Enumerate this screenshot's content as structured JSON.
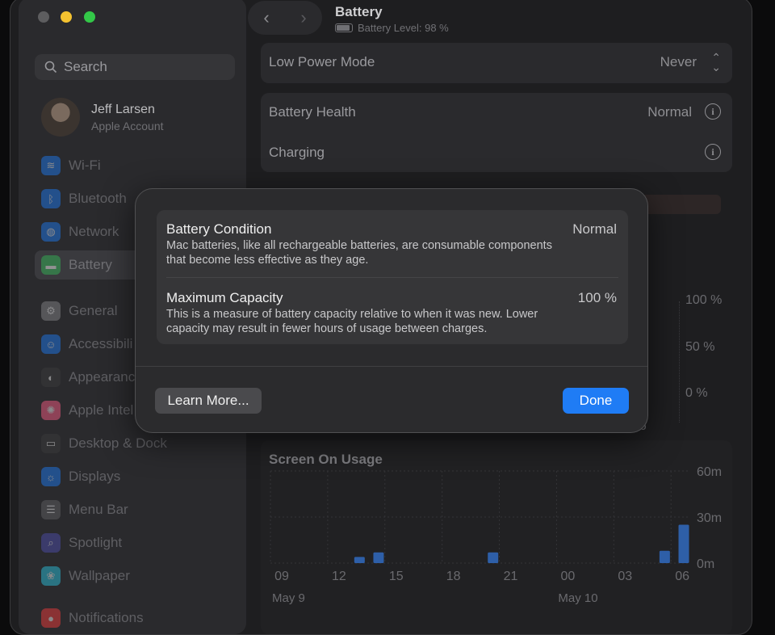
{
  "window": {
    "title": "Battery",
    "subtitle": "Battery Level: 98 %"
  },
  "sidebar": {
    "search_placeholder": "Search",
    "account": {
      "name": "Jeff Larsen",
      "subtitle": "Apple Account"
    },
    "items": [
      {
        "label": "Wi-Fi",
        "icon": "wifi-icon",
        "color": "#1e6fd9"
      },
      {
        "label": "Bluetooth",
        "icon": "bluetooth-icon",
        "color": "#1e6fd9"
      },
      {
        "label": "Network",
        "icon": "globe-icon",
        "color": "#1e6fd9"
      },
      {
        "label": "Battery",
        "icon": "battery-icon",
        "color": "#34a853",
        "active": true
      },
      {
        "label": "General",
        "icon": "gear-icon",
        "color": "#7a7a7e"
      },
      {
        "label": "Accessibili",
        "icon": "accessibility-icon",
        "color": "#1e6fd9"
      },
      {
        "label": "Appearanc",
        "icon": "appearance-icon",
        "color": "#3a3a3a"
      },
      {
        "label": "Apple Intel",
        "icon": "apple-intelligence-icon",
        "color": "#e0567a"
      },
      {
        "label": "Desktop & Dock",
        "icon": "dock-icon",
        "color": "#3a3a3a"
      },
      {
        "label": "Displays",
        "icon": "displays-icon",
        "color": "#1e6fd9"
      },
      {
        "label": "Menu Bar",
        "icon": "menubar-icon",
        "color": "#5a5a5e"
      },
      {
        "label": "Spotlight",
        "icon": "spotlight-icon",
        "color": "#4a4a9e"
      },
      {
        "label": "Wallpaper",
        "icon": "wallpaper-icon",
        "color": "#2ab0c8"
      },
      {
        "label": "Notifications",
        "icon": "notifications-icon",
        "color": "#d93a3a"
      }
    ]
  },
  "main": {
    "low_power": {
      "label": "Low Power Mode",
      "value": "Never"
    },
    "health": {
      "label": "Battery Health",
      "value": "Normal"
    },
    "charging": {
      "label": "Charging"
    },
    "hidden_tab_fragment": "ys",
    "level_chart": {
      "y_ticks": [
        "100 %",
        "50 %",
        "0 %"
      ],
      "x_fragment": "06"
    },
    "usage_chart": {
      "title": "Screen On Usage",
      "y_ticks": [
        "60m",
        "30m",
        "0m"
      ],
      "x_ticks": [
        "09",
        "12",
        "15",
        "18",
        "21",
        "00",
        "03",
        "06"
      ],
      "date_labels": [
        "May 9",
        "May 10"
      ]
    }
  },
  "modal": {
    "condition": {
      "title": "Battery Condition",
      "value": "Normal",
      "description": "Mac batteries, like all rechargeable batteries, are consumable components that become less effective as they age."
    },
    "capacity": {
      "title": "Maximum Capacity",
      "value": "100 %",
      "description": "This is a measure of battery capacity relative to when it was new. Lower capacity may result in fewer hours of usage between charges."
    },
    "learn_more": "Learn More...",
    "done": "Done"
  },
  "chart_data": {
    "type": "bar",
    "title": "Screen On Usage",
    "categories": [
      "09",
      "10",
      "11",
      "12",
      "13",
      "14",
      "15",
      "16",
      "17",
      "18",
      "19",
      "20",
      "21",
      "22",
      "23",
      "00",
      "01",
      "02",
      "03",
      "04",
      "05",
      "06"
    ],
    "values": [
      0,
      0,
      0,
      0,
      4,
      7,
      0,
      0,
      0,
      0,
      0,
      7,
      0,
      0,
      0,
      0,
      0,
      0,
      0,
      0,
      8,
      25
    ],
    "ylabel": "minutes",
    "ylim": [
      0,
      60
    ],
    "y_ticks": [
      "60m",
      "30m",
      "0m"
    ],
    "x_ticks": [
      "09",
      "12",
      "15",
      "18",
      "21",
      "00",
      "03",
      "06"
    ]
  }
}
